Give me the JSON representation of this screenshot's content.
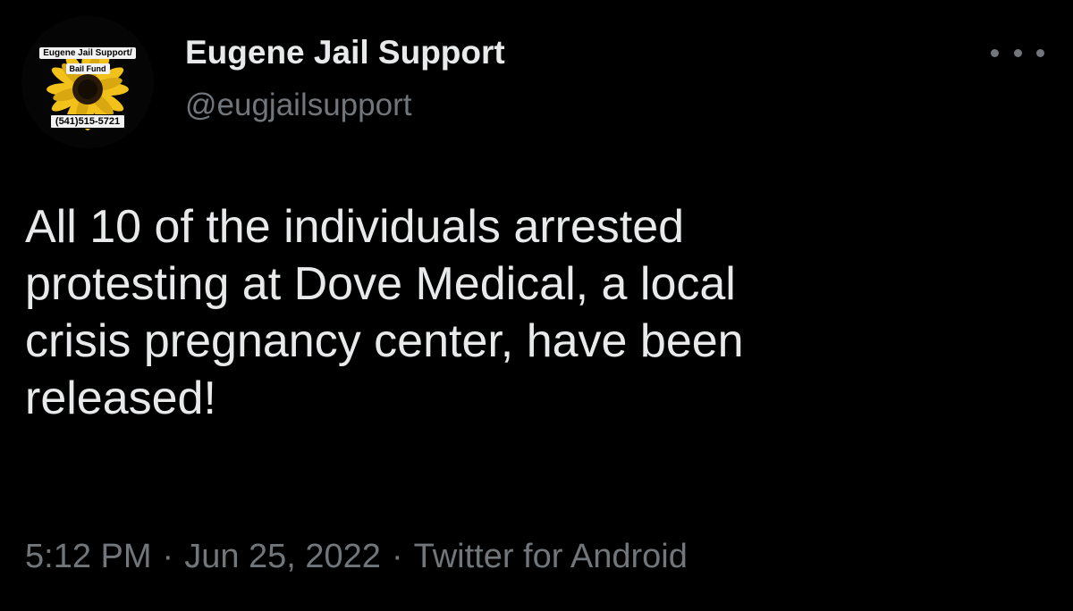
{
  "author": {
    "display_name": "Eugene Jail Support",
    "handle": "@eugjailsupport",
    "avatar": {
      "line1": "Eugene Jail Support/",
      "line2": "Bail Fund",
      "phone": "(541)515-5721",
      "icon": "sunflower-logo"
    }
  },
  "menu": {
    "icon": "more-horizontal-icon"
  },
  "tweet": {
    "lines": [
      "All 10 of the individuals arrested",
      "protesting at Dove Medical, a local",
      "crisis pregnancy center, have been",
      "released!"
    ]
  },
  "meta": {
    "time": "5:12 PM",
    "date": "Jun 25, 2022",
    "source": "Twitter for Android",
    "separator": "·"
  },
  "colors": {
    "background": "#000000",
    "primary_text": "#e7e9ea",
    "secondary_text": "#71767b",
    "sunflower": "#f2c21b"
  }
}
